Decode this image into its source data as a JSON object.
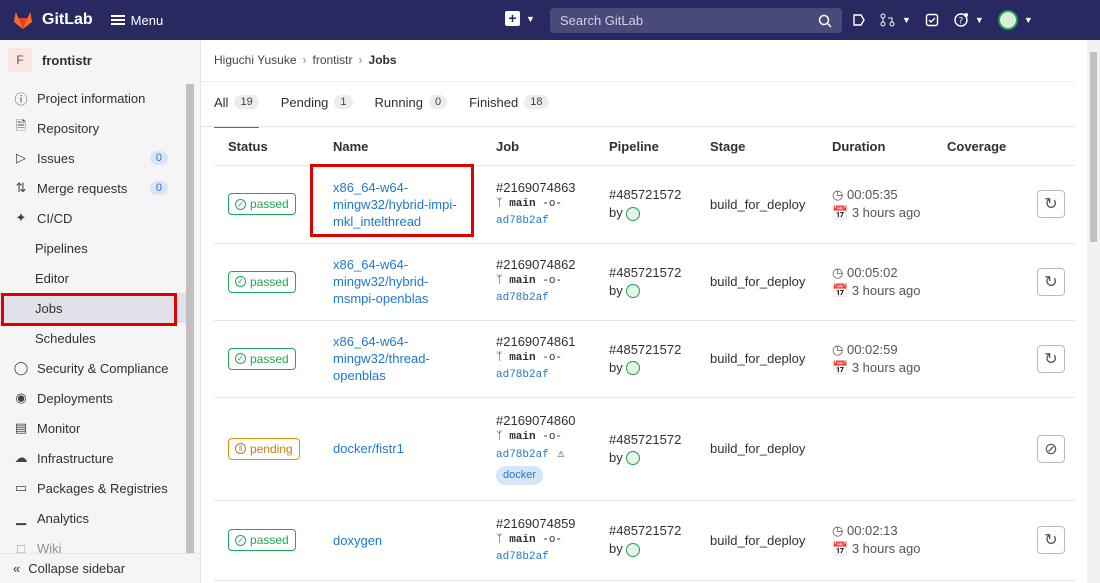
{
  "topbar": {
    "brand": "GitLab",
    "menu_label": "Menu",
    "search_placeholder": "Search GitLab"
  },
  "sidebar": {
    "project_initial": "F",
    "project_name": "frontistr",
    "items": [
      {
        "label": "Project information",
        "icon": "info-icon"
      },
      {
        "label": "Repository",
        "icon": "doc-icon"
      },
      {
        "label": "Issues",
        "icon": "issues-icon",
        "count": "0"
      },
      {
        "label": "Merge requests",
        "icon": "merge-icon",
        "count": "0"
      },
      {
        "label": "CI/CD",
        "icon": "rocket-icon"
      },
      {
        "label": "Pipelines"
      },
      {
        "label": "Editor"
      },
      {
        "label": "Jobs"
      },
      {
        "label": "Schedules"
      },
      {
        "label": "Security & Compliance",
        "icon": "shield-icon"
      },
      {
        "label": "Deployments",
        "icon": "deploy-icon"
      },
      {
        "label": "Monitor",
        "icon": "monitor-icon"
      },
      {
        "label": "Infrastructure",
        "icon": "cloud-icon"
      },
      {
        "label": "Packages & Registries",
        "icon": "package-icon"
      },
      {
        "label": "Analytics",
        "icon": "chart-icon"
      },
      {
        "label": "Wiki",
        "icon": "book-icon"
      }
    ],
    "collapse_label": "Collapse sidebar"
  },
  "breadcrumb": [
    "Higuchi Yusuke",
    "frontistr",
    "Jobs"
  ],
  "tabs": [
    {
      "label": "All",
      "count": "19"
    },
    {
      "label": "Pending",
      "count": "1"
    },
    {
      "label": "Running",
      "count": "0"
    },
    {
      "label": "Finished",
      "count": "18"
    }
  ],
  "columns": [
    "Status",
    "Name",
    "Job",
    "Pipeline",
    "Stage",
    "Duration",
    "Coverage"
  ],
  "jobs": [
    {
      "status": "passed",
      "name": [
        "x86_64-w64-",
        "mingw32/hybrid-impi-",
        "mkl_intelthread"
      ],
      "id": "#2169074863",
      "branch": "main",
      "sha": "ad78b2af",
      "pipeline": "#485721572",
      "by": "by",
      "stage": "build_for_deploy",
      "duration": "00:05:35",
      "finished": "3 hours ago"
    },
    {
      "status": "passed",
      "name": [
        "x86_64-w64-",
        "mingw32/hybrid-",
        "msmpi-openblas"
      ],
      "id": "#2169074862",
      "branch": "main",
      "sha": "ad78b2af",
      "pipeline": "#485721572",
      "by": "by",
      "stage": "build_for_deploy",
      "duration": "00:05:02",
      "finished": "3 hours ago"
    },
    {
      "status": "passed",
      "name": [
        "x86_64-w64-",
        "mingw32/thread-",
        "openblas"
      ],
      "id": "#2169074861",
      "branch": "main",
      "sha": "ad78b2af",
      "pipeline": "#485721572",
      "by": "by",
      "stage": "build_for_deploy",
      "duration": "00:02:59",
      "finished": "3 hours ago"
    },
    {
      "status": "pending",
      "name": [
        "docker/fistr1"
      ],
      "id": "#2169074860",
      "branch": "main",
      "sha": "ad78b2af",
      "tag": "docker",
      "pipeline": "#485721572",
      "by": "by",
      "stage": "build_for_deploy",
      "duration": "",
      "finished": ""
    },
    {
      "status": "passed",
      "name": [
        "doxygen"
      ],
      "id": "#2169074859",
      "branch": "main",
      "sha": "ad78b2af",
      "pipeline": "#485721572",
      "by": "by",
      "stage": "build_for_deploy",
      "duration": "00:02:13",
      "finished": "3 hours ago"
    }
  ]
}
